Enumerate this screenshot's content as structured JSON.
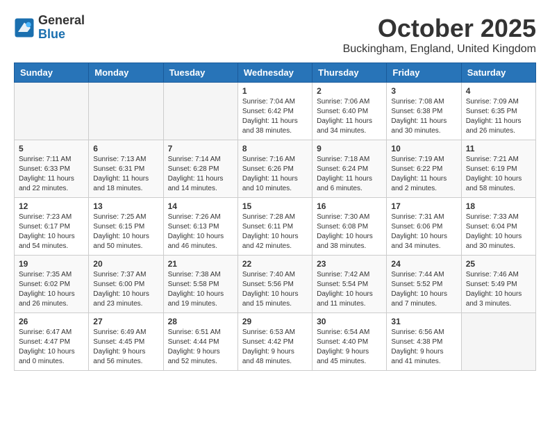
{
  "logo": {
    "general": "General",
    "blue": "Blue"
  },
  "header": {
    "month": "October 2025",
    "location": "Buckingham, England, United Kingdom"
  },
  "days_of_week": [
    "Sunday",
    "Monday",
    "Tuesday",
    "Wednesday",
    "Thursday",
    "Friday",
    "Saturday"
  ],
  "weeks": [
    [
      {
        "day": "",
        "info": ""
      },
      {
        "day": "",
        "info": ""
      },
      {
        "day": "",
        "info": ""
      },
      {
        "day": "1",
        "info": "Sunrise: 7:04 AM\nSunset: 6:42 PM\nDaylight: 11 hours\nand 38 minutes."
      },
      {
        "day": "2",
        "info": "Sunrise: 7:06 AM\nSunset: 6:40 PM\nDaylight: 11 hours\nand 34 minutes."
      },
      {
        "day": "3",
        "info": "Sunrise: 7:08 AM\nSunset: 6:38 PM\nDaylight: 11 hours\nand 30 minutes."
      },
      {
        "day": "4",
        "info": "Sunrise: 7:09 AM\nSunset: 6:35 PM\nDaylight: 11 hours\nand 26 minutes."
      }
    ],
    [
      {
        "day": "5",
        "info": "Sunrise: 7:11 AM\nSunset: 6:33 PM\nDaylight: 11 hours\nand 22 minutes."
      },
      {
        "day": "6",
        "info": "Sunrise: 7:13 AM\nSunset: 6:31 PM\nDaylight: 11 hours\nand 18 minutes."
      },
      {
        "day": "7",
        "info": "Sunrise: 7:14 AM\nSunset: 6:28 PM\nDaylight: 11 hours\nand 14 minutes."
      },
      {
        "day": "8",
        "info": "Sunrise: 7:16 AM\nSunset: 6:26 PM\nDaylight: 11 hours\nand 10 minutes."
      },
      {
        "day": "9",
        "info": "Sunrise: 7:18 AM\nSunset: 6:24 PM\nDaylight: 11 hours\nand 6 minutes."
      },
      {
        "day": "10",
        "info": "Sunrise: 7:19 AM\nSunset: 6:22 PM\nDaylight: 11 hours\nand 2 minutes."
      },
      {
        "day": "11",
        "info": "Sunrise: 7:21 AM\nSunset: 6:19 PM\nDaylight: 10 hours\nand 58 minutes."
      }
    ],
    [
      {
        "day": "12",
        "info": "Sunrise: 7:23 AM\nSunset: 6:17 PM\nDaylight: 10 hours\nand 54 minutes."
      },
      {
        "day": "13",
        "info": "Sunrise: 7:25 AM\nSunset: 6:15 PM\nDaylight: 10 hours\nand 50 minutes."
      },
      {
        "day": "14",
        "info": "Sunrise: 7:26 AM\nSunset: 6:13 PM\nDaylight: 10 hours\nand 46 minutes."
      },
      {
        "day": "15",
        "info": "Sunrise: 7:28 AM\nSunset: 6:11 PM\nDaylight: 10 hours\nand 42 minutes."
      },
      {
        "day": "16",
        "info": "Sunrise: 7:30 AM\nSunset: 6:08 PM\nDaylight: 10 hours\nand 38 minutes."
      },
      {
        "day": "17",
        "info": "Sunrise: 7:31 AM\nSunset: 6:06 PM\nDaylight: 10 hours\nand 34 minutes."
      },
      {
        "day": "18",
        "info": "Sunrise: 7:33 AM\nSunset: 6:04 PM\nDaylight: 10 hours\nand 30 minutes."
      }
    ],
    [
      {
        "day": "19",
        "info": "Sunrise: 7:35 AM\nSunset: 6:02 PM\nDaylight: 10 hours\nand 26 minutes."
      },
      {
        "day": "20",
        "info": "Sunrise: 7:37 AM\nSunset: 6:00 PM\nDaylight: 10 hours\nand 23 minutes."
      },
      {
        "day": "21",
        "info": "Sunrise: 7:38 AM\nSunset: 5:58 PM\nDaylight: 10 hours\nand 19 minutes."
      },
      {
        "day": "22",
        "info": "Sunrise: 7:40 AM\nSunset: 5:56 PM\nDaylight: 10 hours\nand 15 minutes."
      },
      {
        "day": "23",
        "info": "Sunrise: 7:42 AM\nSunset: 5:54 PM\nDaylight: 10 hours\nand 11 minutes."
      },
      {
        "day": "24",
        "info": "Sunrise: 7:44 AM\nSunset: 5:52 PM\nDaylight: 10 hours\nand 7 minutes."
      },
      {
        "day": "25",
        "info": "Sunrise: 7:46 AM\nSunset: 5:49 PM\nDaylight: 10 hours\nand 3 minutes."
      }
    ],
    [
      {
        "day": "26",
        "info": "Sunrise: 6:47 AM\nSunset: 4:47 PM\nDaylight: 10 hours\nand 0 minutes."
      },
      {
        "day": "27",
        "info": "Sunrise: 6:49 AM\nSunset: 4:45 PM\nDaylight: 9 hours\nand 56 minutes."
      },
      {
        "day": "28",
        "info": "Sunrise: 6:51 AM\nSunset: 4:44 PM\nDaylight: 9 hours\nand 52 minutes."
      },
      {
        "day": "29",
        "info": "Sunrise: 6:53 AM\nSunset: 4:42 PM\nDaylight: 9 hours\nand 48 minutes."
      },
      {
        "day": "30",
        "info": "Sunrise: 6:54 AM\nSunset: 4:40 PM\nDaylight: 9 hours\nand 45 minutes."
      },
      {
        "day": "31",
        "info": "Sunrise: 6:56 AM\nSunset: 4:38 PM\nDaylight: 9 hours\nand 41 minutes."
      },
      {
        "day": "",
        "info": ""
      }
    ]
  ]
}
